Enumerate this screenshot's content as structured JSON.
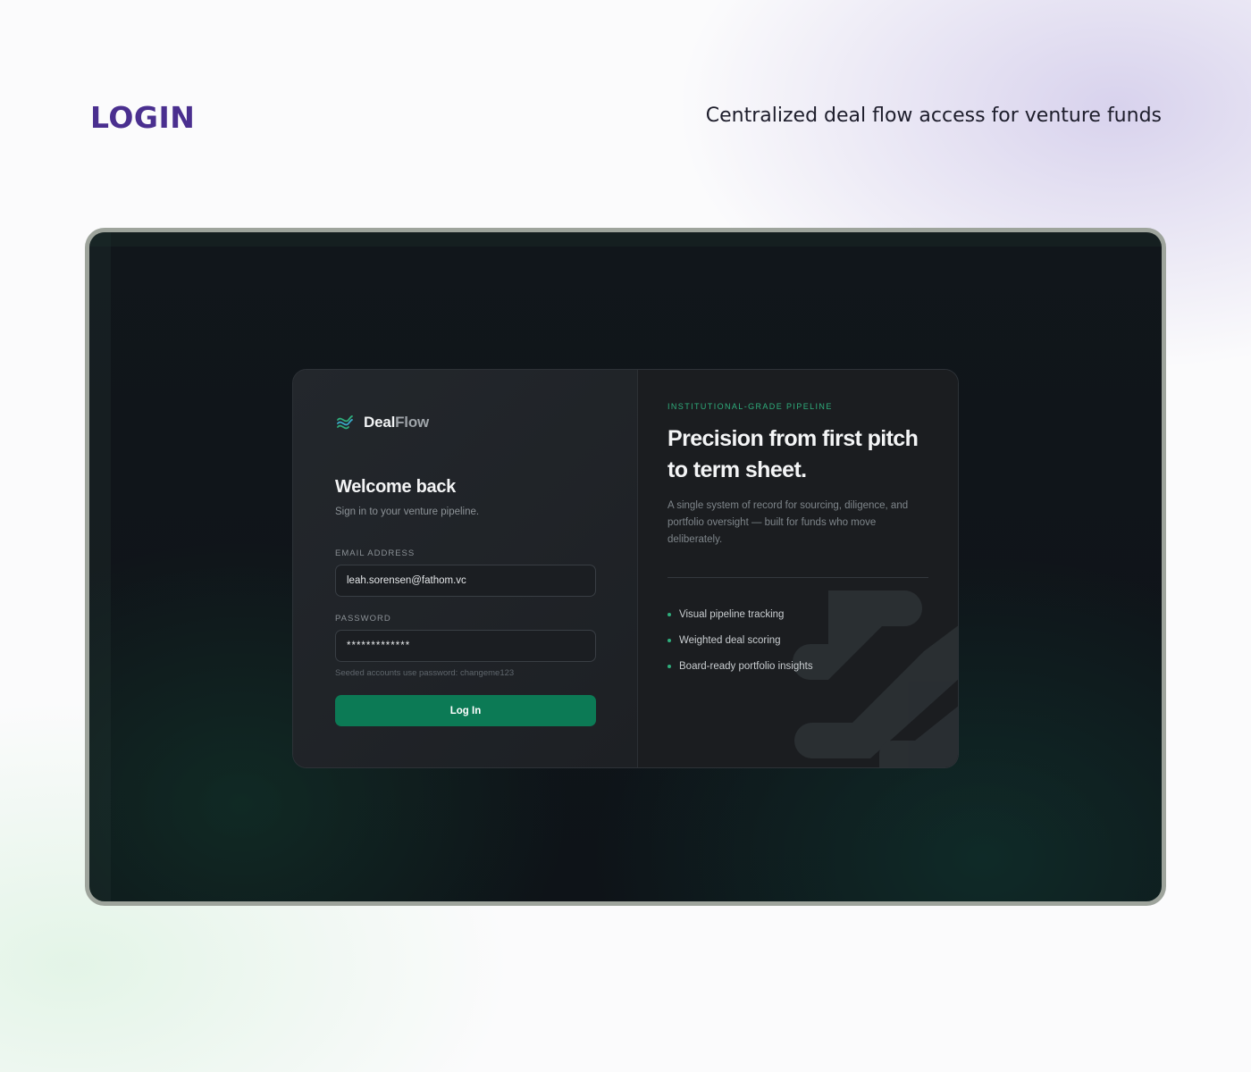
{
  "page": {
    "heading": "LOGIN",
    "tagline": "Centralized deal flow access for venture funds"
  },
  "brand": {
    "name_part1": "Deal",
    "name_part2": "Flow",
    "icon": "wave-logo-icon"
  },
  "login": {
    "title": "Welcome back",
    "subtitle": "Sign in to your venture pipeline.",
    "email_label": "EMAIL ADDRESS",
    "email_value": "leah.sorensen@fathom.vc",
    "password_label": "PASSWORD",
    "password_value": "*************",
    "hint": "Seeded accounts use password: changeme123",
    "button_label": "Log In"
  },
  "promo": {
    "eyebrow": "INSTITUTIONAL-GRADE PIPELINE",
    "headline": "Precision from first pitch to term sheet.",
    "description": "A single system of record for sourcing, diligence, and portfolio oversight — built for funds who move deliberately.",
    "features": [
      "Visual pipeline tracking",
      "Weighted deal scoring",
      "Board-ready portfolio insights"
    ]
  },
  "colors": {
    "heading": "#4a2f8f",
    "accent": "#2fae7c",
    "button": "#0c7a55"
  }
}
